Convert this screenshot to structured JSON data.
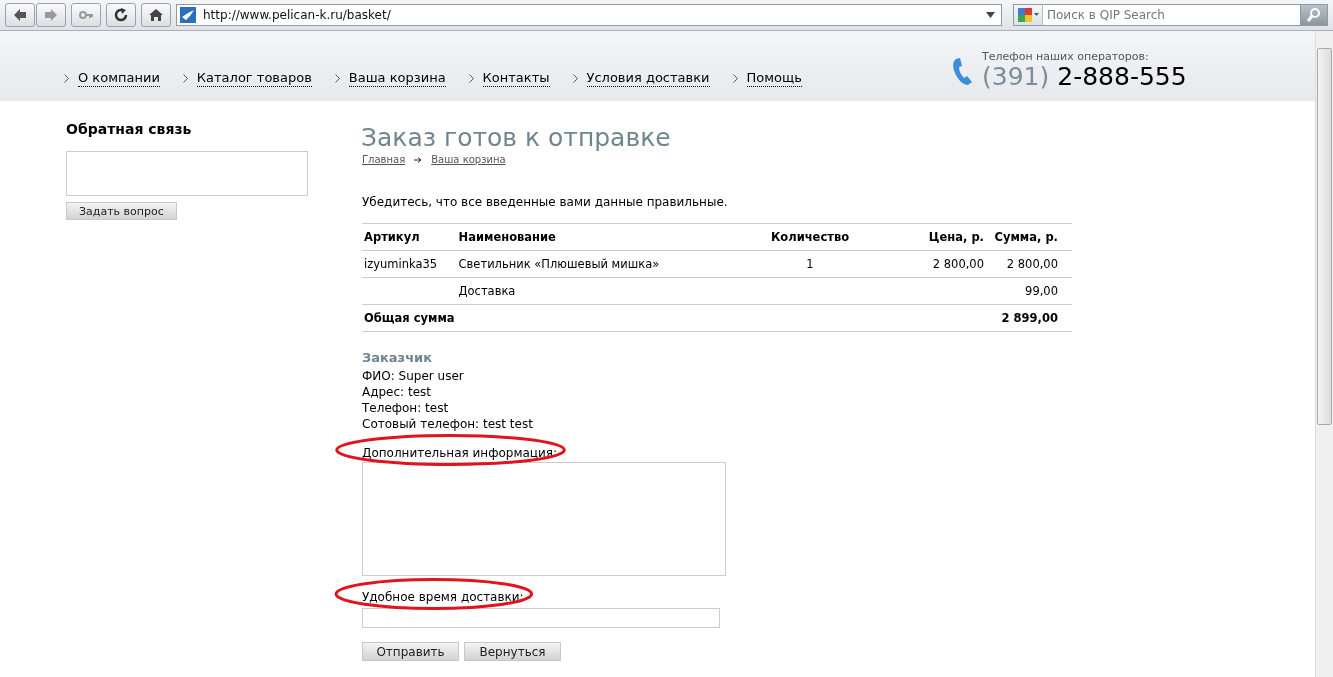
{
  "browser": {
    "url": "http://www.pelican-k.ru/basket/",
    "search_placeholder": "Поиск в QIP Search"
  },
  "nav": [
    "О компании",
    "Каталог товаров",
    "Ваша корзина",
    "Контакты",
    "Условия доставки",
    "Помощь"
  ],
  "phone": {
    "caption": "Телефон наших операторов:",
    "code": "(391)",
    "number": "2-888-555"
  },
  "sidebar": {
    "title": "Обратная связь",
    "button": "Задать вопрос"
  },
  "page": {
    "title": "Заказ готов к отправке",
    "breadcrumbs": [
      "Главная",
      "Ваша корзина"
    ],
    "intro": "Убедитесь, что все введенные вами данные правильные."
  },
  "table": {
    "columns": [
      "Артикул",
      "Наименование",
      "Количество",
      "Цена, р.",
      "Сумма, р."
    ],
    "rows": [
      {
        "kind": "item",
        "cells": [
          "izyuminka35",
          "Светильник «Плюшевый мишка»",
          "1",
          "2 800,00",
          "2 800,00"
        ]
      },
      {
        "kind": "item",
        "cells": [
          "",
          "Доставка",
          "",
          "",
          "99,00"
        ]
      },
      {
        "kind": "total",
        "cells": [
          "Общая сумма",
          "",
          "",
          "",
          "2 899,00"
        ]
      }
    ]
  },
  "customer": {
    "title": "Заказчик",
    "lines": [
      "ФИО: Super user",
      "Адрес: test",
      "Телефон: test",
      "Сотовый телефон: test test"
    ]
  },
  "fields": [
    {
      "kind": "textarea",
      "label": "Дополнительная информация:",
      "circled": true
    },
    {
      "kind": "input",
      "label": "Удобное время доставки:",
      "circled": true
    }
  ],
  "buttons": [
    "Отправить",
    "Вернуться"
  ]
}
